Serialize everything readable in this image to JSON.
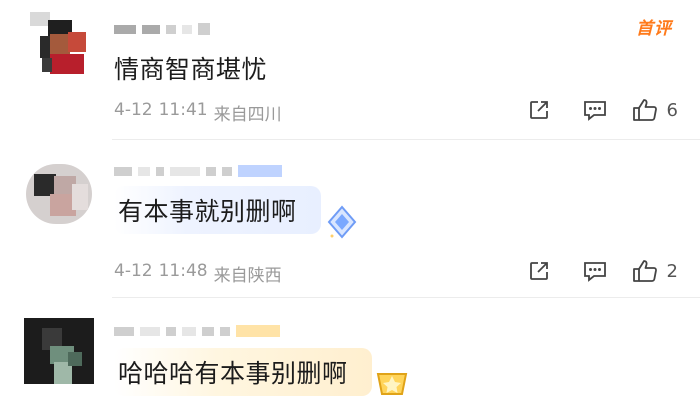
{
  "comments": [
    {
      "text": "情商智商堪忧",
      "date": "4-12",
      "time": "11:41",
      "location": "来自四川",
      "likes": "6",
      "badge": "首评"
    },
    {
      "text": "有本事就别删啊",
      "date": "4-12",
      "time": "11:48",
      "location": "来自陕西",
      "likes": "2"
    },
    {
      "text": "哈哈哈有本事别删啊"
    }
  ],
  "icons": [
    "share-icon",
    "comment-icon",
    "thumbs-up-icon",
    "diamond-badge-icon",
    "gold-badge-icon"
  ],
  "colors": {
    "accent": "#ff7a1a",
    "meta": "#9a9a9a",
    "bubble_blue": "#e8efff",
    "bubble_gold": "#ffefcf"
  }
}
